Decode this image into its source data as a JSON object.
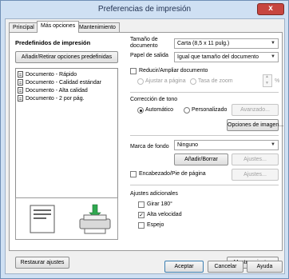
{
  "window": {
    "title": "Preferencias de impresión",
    "close": "x"
  },
  "tabs": [
    "Principal",
    "Más opciones",
    "Mantenimiento"
  ],
  "presets": {
    "heading": "Predefinidos de impresión",
    "add_remove": "Añadir/Retirar opciones predefinidas",
    "items": [
      "Documento - Rápido",
      "Documento - Calidad estándar",
      "Documento - Alta calidad",
      "Documento - 2 por pág."
    ]
  },
  "paper": {
    "size_label_1": "Tamaño de",
    "size_label_2": "documento",
    "size_value": "Carta (8,5 x 11 pulg.)",
    "output_label": "Papel de salida",
    "output_value": "Igual que tamaño del documento",
    "reduce_label": "Reducir/Ampliar documento",
    "fit_page": "Ajustar a página",
    "zoom_rate": "Tasa de zoom",
    "zoom_unit": "%"
  },
  "color": {
    "label": "Corrección de tono",
    "auto": "Automático",
    "custom": "Personalizado",
    "advanced": "Avanzado...",
    "image_options": "Opciones de imagen..."
  },
  "watermark": {
    "label": "Marca de fondo",
    "value": "Ninguno",
    "add_delete": "Añadir/Borrar",
    "settings": "Ajustes..."
  },
  "header_footer": {
    "label": "Encabezado/Pie de página",
    "settings": "Ajustes..."
  },
  "extra": {
    "label": "Ajustes adicionales",
    "rotate": "Girar 180°",
    "high_speed": "Alta velocidad",
    "mirror": "Espejo"
  },
  "bottom": {
    "reset": "Restaurar ajustes",
    "show": "Mostrar ajustes",
    "ok": "Aceptar",
    "cancel": "Cancelar",
    "help": "Ayuda"
  },
  "state": {
    "color_mode": "Automático",
    "high_speed_checked": true
  }
}
